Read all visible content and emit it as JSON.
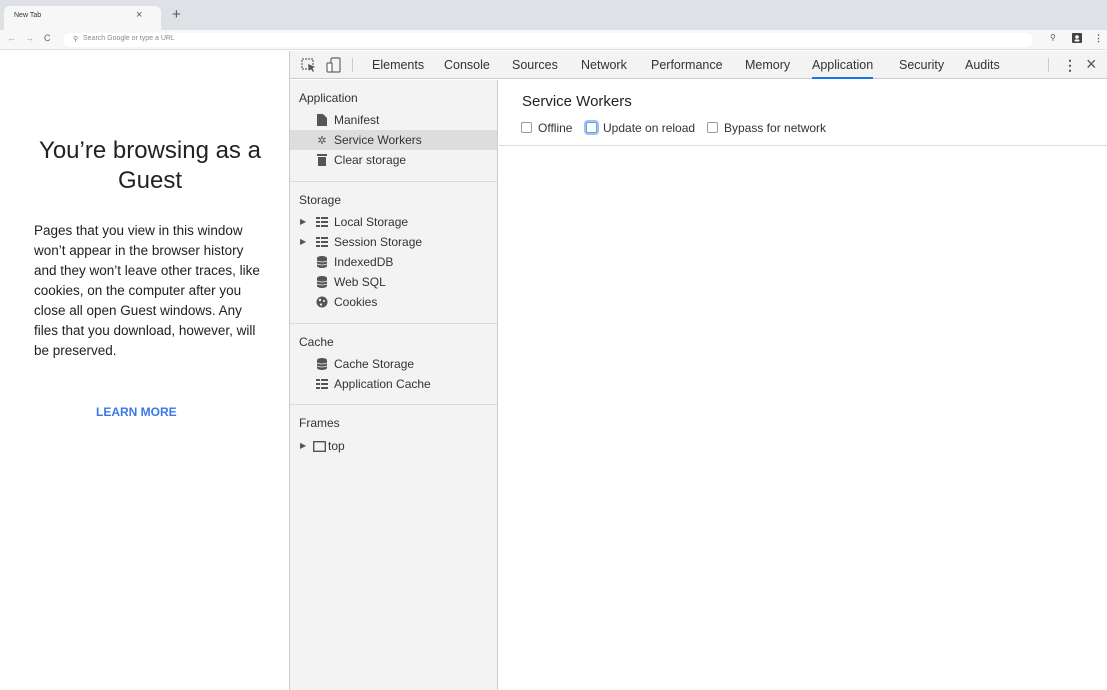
{
  "browser": {
    "tab_title": "New Tab",
    "tab_close": "×",
    "new_tab": "+",
    "omnibox_placeholder": "Search Google or type a URL"
  },
  "guest_page": {
    "title": "You’re browsing as a Guest",
    "body": "Pages that you view in this window won’t appear in the browser history and they won’t leave other traces, like cookies, on the computer after you close all open Guest windows. Any files that you download, however, will be preserved.",
    "learn_more": "LEARN MORE"
  },
  "devtools": {
    "tabs": [
      {
        "label": "Elements",
        "active": false
      },
      {
        "label": "Console",
        "active": false
      },
      {
        "label": "Sources",
        "active": false
      },
      {
        "label": "Network",
        "active": false
      },
      {
        "label": "Performance",
        "active": false
      },
      {
        "label": "Memory",
        "active": false
      },
      {
        "label": "Application",
        "active": true
      },
      {
        "label": "Security",
        "active": false
      },
      {
        "label": "Audits",
        "active": false
      }
    ],
    "sidebar": {
      "application": {
        "heading": "Application",
        "items": [
          {
            "label": "Manifest",
            "icon": "file-icon"
          },
          {
            "label": "Service Workers",
            "icon": "gear-icon",
            "selected": true
          },
          {
            "label": "Clear storage",
            "icon": "trash-icon"
          }
        ]
      },
      "storage": {
        "heading": "Storage",
        "items": [
          {
            "label": "Local Storage",
            "icon": "grid-icon",
            "expandable": true
          },
          {
            "label": "Session Storage",
            "icon": "grid-icon",
            "expandable": true
          },
          {
            "label": "IndexedDB",
            "icon": "database-icon"
          },
          {
            "label": "Web SQL",
            "icon": "database-icon"
          },
          {
            "label": "Cookies",
            "icon": "cookie-icon"
          }
        ]
      },
      "cache": {
        "heading": "Cache",
        "items": [
          {
            "label": "Cache Storage",
            "icon": "database-icon"
          },
          {
            "label": "Application Cache",
            "icon": "grid-icon"
          }
        ]
      },
      "frames": {
        "heading": "Frames",
        "items": [
          {
            "label": "top",
            "icon": "frame-icon",
            "expandable": true
          }
        ]
      }
    },
    "main": {
      "title": "Service Workers",
      "options": [
        {
          "label": "Offline",
          "checked": false
        },
        {
          "label": "Update on reload",
          "checked": false,
          "focused": true
        },
        {
          "label": "Bypass for network",
          "checked": false
        }
      ]
    }
  },
  "colors": {
    "accent": "#1a73e8",
    "link": "#3b78e7",
    "sidebar_bg": "#f3f3f3",
    "selected_bg": "#dddddd"
  }
}
